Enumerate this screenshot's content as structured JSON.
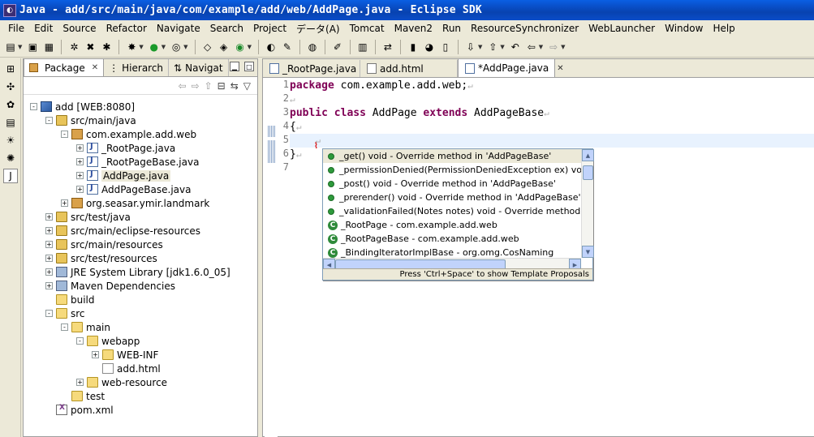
{
  "window": {
    "title": "Java - add/src/main/java/com/example/add/web/AddPage.java - Eclipse SDK"
  },
  "menubar": {
    "items": [
      "File",
      "Edit",
      "Source",
      "Refactor",
      "Navigate",
      "Search",
      "Project",
      "データ(A)",
      "Tomcat",
      "Maven2",
      "Run",
      "ResourceSynchronizer",
      "WebLauncher",
      "Window",
      "Help"
    ]
  },
  "package_explorer": {
    "tabs": [
      {
        "label": "Package"
      },
      {
        "label": "Hierarch"
      },
      {
        "label": "Navigat"
      }
    ],
    "tree": [
      {
        "label": "add [WEB:8080]",
        "expander": "-"
      },
      {
        "label": "src/main/java",
        "expander": "-"
      },
      {
        "label": "com.example.add.web",
        "expander": "-"
      },
      {
        "label": "_RootPage.java",
        "expander": "+"
      },
      {
        "label": "_RootPageBase.java",
        "expander": "+"
      },
      {
        "label": "AddPage.java",
        "expander": "+"
      },
      {
        "label": "AddPageBase.java",
        "expander": "+"
      },
      {
        "label": "org.seasar.ymir.landmark",
        "expander": "+"
      },
      {
        "label": "src/test/java",
        "expander": "+"
      },
      {
        "label": "src/main/eclipse-resources",
        "expander": "+"
      },
      {
        "label": "src/main/resources",
        "expander": "+"
      },
      {
        "label": "src/test/resources",
        "expander": "+"
      },
      {
        "label": "JRE System Library [jdk1.6.0_05]",
        "expander": "+"
      },
      {
        "label": "Maven Dependencies",
        "expander": "+"
      },
      {
        "label": "build",
        "expander": ""
      },
      {
        "label": "src",
        "expander": "-"
      },
      {
        "label": "main",
        "expander": "-"
      },
      {
        "label": "webapp",
        "expander": "-"
      },
      {
        "label": "WEB-INF",
        "expander": "+"
      },
      {
        "label": "add.html",
        "expander": ""
      },
      {
        "label": "web-resource",
        "expander": "+"
      },
      {
        "label": "test",
        "expander": ""
      },
      {
        "label": "pom.xml",
        "expander": ""
      }
    ]
  },
  "editor": {
    "tabs": [
      {
        "label": "_RootPage.java"
      },
      {
        "label": "add.html"
      },
      {
        "label": "*AddPage.java"
      }
    ],
    "line_numbers": [
      "1",
      "2",
      "3",
      "4",
      "5",
      "6",
      "7"
    ],
    "lines": {
      "l1_kw": "package",
      "l1_rest": " com.example.add.web;",
      "l3_kw1": "public",
      "l3_kw2": "class",
      "l3_name": " AddPage ",
      "l3_kw3": "extends",
      "l3_base": " AddPageBase",
      "l4": "{",
      "l6": "}",
      "ret": "↵"
    }
  },
  "content_assist": {
    "items": [
      {
        "label": "_get()  void - Override method in 'AddPageBase'"
      },
      {
        "label": "_permissionDenied(PermissionDeniedException ex)  void"
      },
      {
        "label": "_post()  void - Override method in 'AddPageBase'"
      },
      {
        "label": "_prerender()  void - Override method in 'AddPageBase'"
      },
      {
        "label": "_validationFailed(Notes notes)  void - Override method in"
      },
      {
        "label": "_RootPage - com.example.add.web"
      },
      {
        "label": "_RootPageBase - com.example.add.web"
      },
      {
        "label": "_BindingIteratorImplBase - org.omg.CosNaming"
      }
    ],
    "status": "Press 'Ctrl+Space' to show Template Proposals"
  }
}
